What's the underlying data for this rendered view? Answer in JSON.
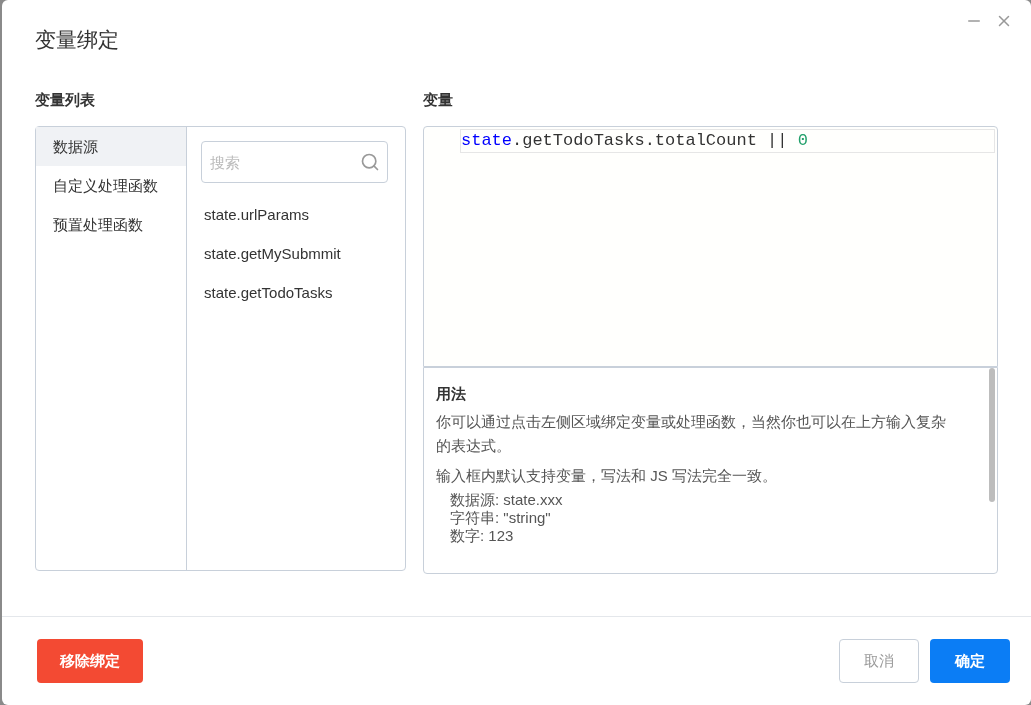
{
  "dialog": {
    "title": "变量绑定"
  },
  "variable_list": {
    "heading": "变量列表",
    "categories": [
      {
        "label": "数据源",
        "selected": true
      },
      {
        "label": "自定义处理函数",
        "selected": false
      },
      {
        "label": "预置处理函数",
        "selected": false
      }
    ],
    "search": {
      "placeholder": "搜索"
    },
    "items": [
      "state.urlParams",
      "state.getMySubmmit",
      "state.getTodoTasks"
    ]
  },
  "variable": {
    "heading": "变量",
    "code": [
      {
        "kind": "keyword",
        "text": "state"
      },
      {
        "kind": "plain",
        "text": ".getTodoTasks.totalCount || "
      },
      {
        "kind": "number",
        "text": "0"
      }
    ]
  },
  "usage": {
    "title": "用法",
    "paragraphs": [
      "你可以通过点击左侧区域绑定变量或处理函数，当然你也可以在上方输入复杂的表达式。",
      "输入框内默认支持变量，写法和 JS 写法完全一致。"
    ],
    "examples": [
      "数据源: state.xxx",
      "字符串: \"string\"",
      "数字: 123"
    ]
  },
  "footer": {
    "remove_button": "移除绑定",
    "cancel_button": "取消",
    "confirm_button": "确定"
  }
}
